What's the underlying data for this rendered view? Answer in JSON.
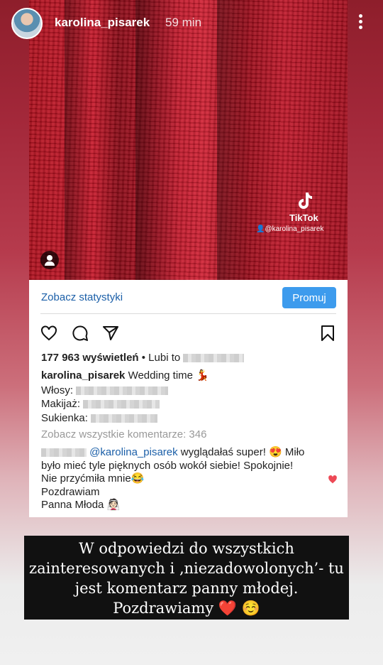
{
  "story": {
    "username": "karolina_pisarek",
    "time": "59 min"
  },
  "post": {
    "tiktok": {
      "brand": "TikTok",
      "handle": "@karolina_pisarek"
    },
    "stats_link": "Zobacz statystyki",
    "promote_label": "Promuj",
    "views": "177 963 wyświetleń",
    "liked_by": "• Lubi to",
    "caption": {
      "username": "karolina_pisarek",
      "text": "Wedding time 💃",
      "hair_label": "Włosy:",
      "makeup_label": "Makijaż:",
      "dress_label": "Sukienka:"
    },
    "view_comments": "Zobacz wszystkie komentarze: 346",
    "comment": {
      "mention": "@karolina_pisarek",
      "line1_rest": " wyglądałaś super! 😍 Miło",
      "line2": "było mieć tyle pięknych osób wokół siebie! Spokojnie!",
      "line3": "Nie przyćmiła mnie😂",
      "line4": "Pozdrawiam",
      "line5": "Panna Młoda 👰🏻"
    }
  },
  "overlay": {
    "line1": "W odpowiedzi do wszystkich",
    "line2": "zainteresowanych i ‚niezadowolonych’- tu",
    "line3": "jest komentarz panny młodej.",
    "line4": "Pozdrawiamy ❤️ ☺️"
  },
  "colors": {
    "accent_blue": "#3d9bed",
    "link_blue": "#1b5fa8",
    "heart_red": "#ed4956"
  }
}
